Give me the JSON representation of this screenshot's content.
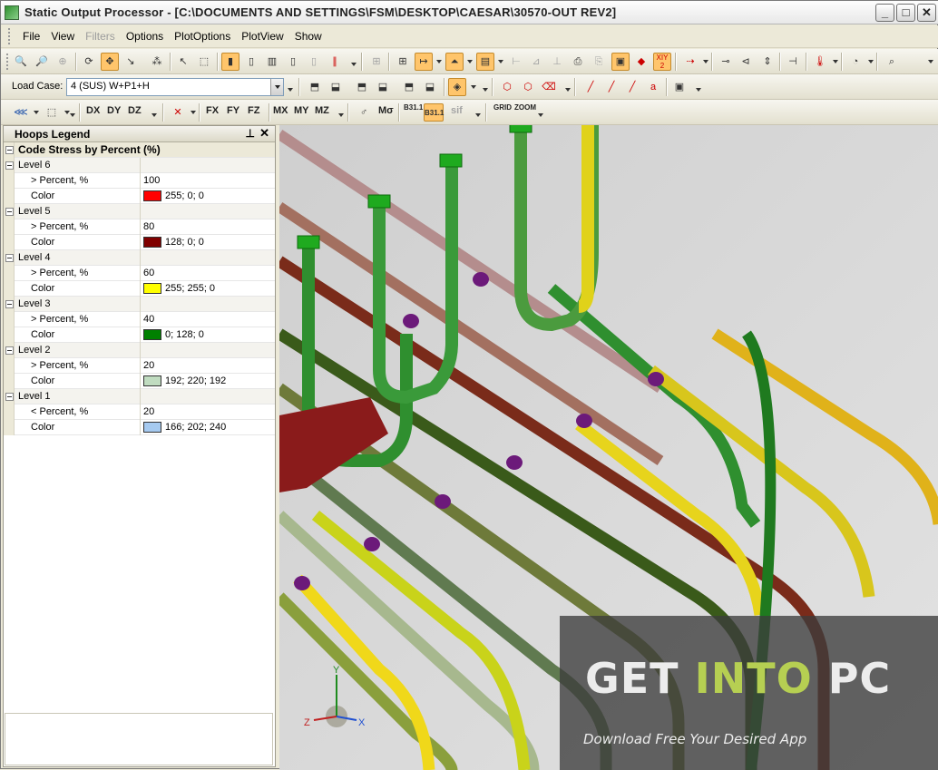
{
  "window": {
    "title": "Static Output Processor - [C:\\DOCUMENTS AND SETTINGS\\FSM\\DESKTOP\\CAESAR\\30570-OUT REV2]",
    "buttons": {
      "minimize": "_",
      "maximize": "□",
      "close": "✕"
    }
  },
  "menu": {
    "items": [
      {
        "label": "File",
        "enabled": true
      },
      {
        "label": "View",
        "enabled": true
      },
      {
        "label": "Filters",
        "enabled": false
      },
      {
        "label": "Options",
        "enabled": true
      },
      {
        "label": "PlotOptions",
        "enabled": true
      },
      {
        "label": "PlotView",
        "enabled": true
      },
      {
        "label": "Show",
        "enabled": true
      }
    ]
  },
  "toolbar2": {
    "load_case_label": "Load Case:",
    "load_case_value": "4 (SUS) W+P1+H"
  },
  "toolbar3": {
    "dx": "DX",
    "dy": "DY",
    "dz": "DZ",
    "fx": "FX",
    "fy": "FY",
    "fz": "FZ",
    "mx": "MX",
    "my": "MY",
    "mz": "MZ",
    "ms": "Mσ",
    "b311a": "B31.1",
    "b311b": "B31.1",
    "sif": "sif",
    "grid": "GRID",
    "zoom": "ZOOM"
  },
  "legend": {
    "title": "Hoops Legend",
    "category": "Code Stress by Percent (%)",
    "levels": [
      {
        "name": "Level 6",
        "pct_label": "> Percent, %",
        "pct": "100",
        "color_label": "Color",
        "color_text": "255; 0; 0",
        "color": "#ff0000"
      },
      {
        "name": "Level 5",
        "pct_label": "> Percent, %",
        "pct": "80",
        "color_label": "Color",
        "color_text": "128; 0; 0",
        "color": "#800000"
      },
      {
        "name": "Level 4",
        "pct_label": "> Percent, %",
        "pct": "60",
        "color_label": "Color",
        "color_text": "255; 255; 0",
        "color": "#ffff00"
      },
      {
        "name": "Level 3",
        "pct_label": "> Percent, %",
        "pct": "40",
        "color_label": "Color",
        "color_text": "0; 128; 0",
        "color": "#008000"
      },
      {
        "name": "Level 2",
        "pct_label": "> Percent, %",
        "pct": "20",
        "color_label": "Color",
        "color_text": "192; 220; 192",
        "color": "#c0dcc0"
      },
      {
        "name": "Level 1",
        "pct_label": "< Percent, %",
        "pct": "20",
        "color_label": "Color",
        "color_text": "166; 202; 240",
        "color": "#a6caf0"
      }
    ]
  },
  "axes": {
    "x": "X",
    "y": "Y",
    "z": "Z"
  },
  "watermark": {
    "get": "GET ",
    "into": "INTO",
    "pc": " PC",
    "subtitle": "Download Free Your Desired App"
  }
}
